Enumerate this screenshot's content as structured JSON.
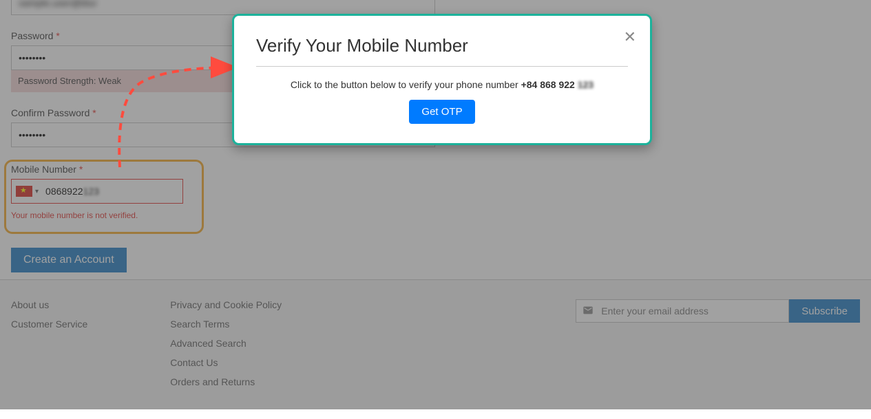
{
  "form": {
    "email": {
      "value": "sample.user@blur"
    },
    "password": {
      "label": "Password",
      "value": "••••••••",
      "strength": "Password Strength: Weak"
    },
    "confirm_password": {
      "label": "Confirm Password",
      "value": "••••••••"
    },
    "mobile": {
      "label": "Mobile Number",
      "value_visible": "0868922",
      "value_blur": "123",
      "error": "Your mobile number is not verified."
    },
    "submit_label": "Create an Account"
  },
  "modal": {
    "title": "Verify Your Mobile Number",
    "body_prefix": "Click to the button below to verify your phone number ",
    "phone_bold": "+84 868 922 ",
    "phone_blur": "123",
    "otp_label": "Get OTP"
  },
  "footer": {
    "col1": [
      "About us",
      "Customer Service"
    ],
    "col2": [
      "Privacy and Cookie Policy",
      "Search Terms",
      "Advanced Search",
      "Contact Us",
      "Orders and Returns"
    ],
    "newsletter": {
      "placeholder": "Enter your email address",
      "button": "Subscribe"
    }
  }
}
